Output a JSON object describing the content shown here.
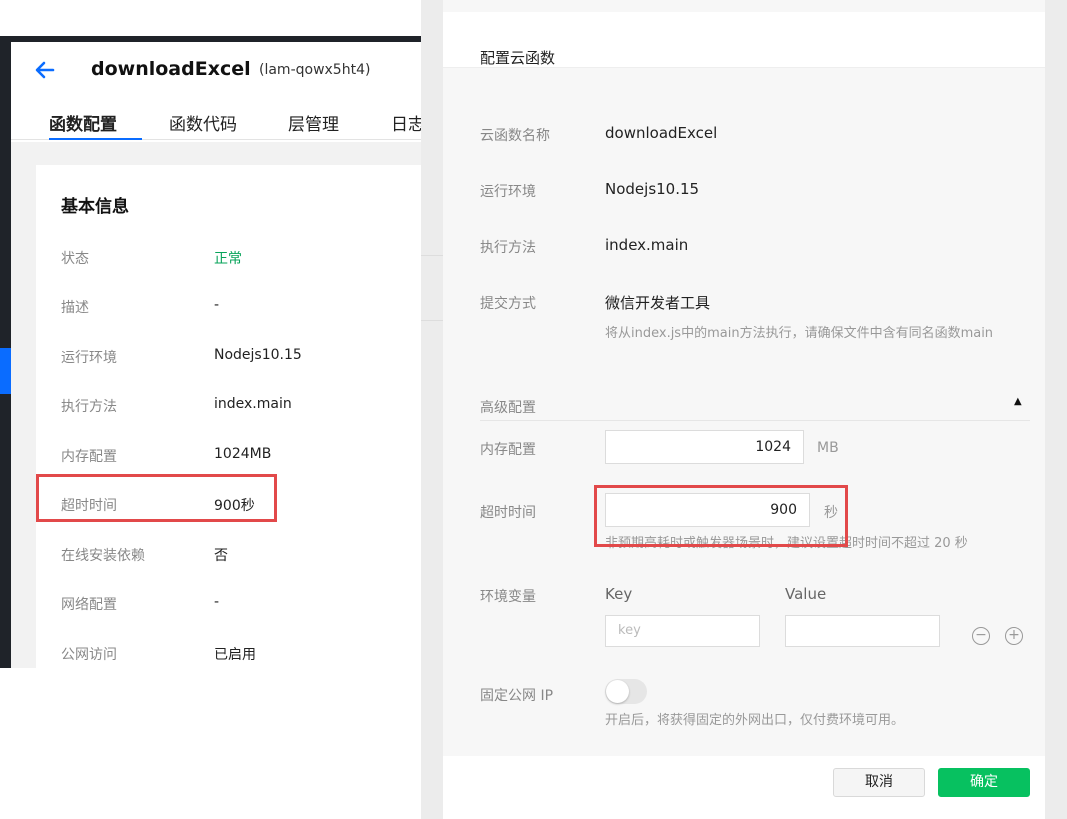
{
  "left": {
    "function_name": "downloadExcel",
    "function_id": "(lam-qowx5ht4)",
    "tabs": [
      "函数配置",
      "函数代码",
      "层管理",
      "日志"
    ],
    "active_tab": "函数配置",
    "section_title": "基本信息",
    "rows": [
      {
        "label": "状态",
        "value": "正常"
      },
      {
        "label": "描述",
        "value": "-"
      },
      {
        "label": "运行环境",
        "value": "Nodejs10.15"
      },
      {
        "label": "执行方法",
        "value": "index.main"
      },
      {
        "label": "内存配置",
        "value": "1024MB"
      },
      {
        "label": "超时时间",
        "value": "900秒"
      },
      {
        "label": "在线安装依赖",
        "value": "否"
      },
      {
        "label": "网络配置",
        "value": "-"
      },
      {
        "label": "公网访问",
        "value": "已启用"
      }
    ],
    "status_color": "#07a35a"
  },
  "dialog": {
    "title": "配置云函数",
    "name_label": "云函数名称",
    "name_value": "downloadExcel",
    "runtime_label": "运行环境",
    "runtime_value": "Nodejs10.15",
    "handler_label": "执行方法",
    "handler_value": "index.main",
    "submit_label": "提交方式",
    "submit_value": "微信开发者工具",
    "submit_hint": "将从index.js中的main方法执行，请确保文件中含有同名函数main",
    "advanced_label": "高级配置",
    "memory_label": "内存配置",
    "memory_value": "1024",
    "memory_unit": "MB",
    "timeout_label": "超时时间",
    "timeout_value": "900",
    "timeout_unit": "秒",
    "timeout_hint": "非预期高耗时或触发器场景时，建议设置超时时间不超过 20 秒",
    "env_label": "环境变量",
    "env_key_header": "Key",
    "env_value_header": "Value",
    "env_key_placeholder": "key",
    "env_value_placeholder": "",
    "fixed_ip_label": "固定公网 IP",
    "fixed_ip_enabled": false,
    "fixed_ip_hint": "开启后，将获得固定的外网出口，仅付费环境可用。",
    "cancel_label": "取消",
    "ok_label": "确定",
    "ok_color": "#07c160",
    "highlight_color": "#e2494a"
  }
}
